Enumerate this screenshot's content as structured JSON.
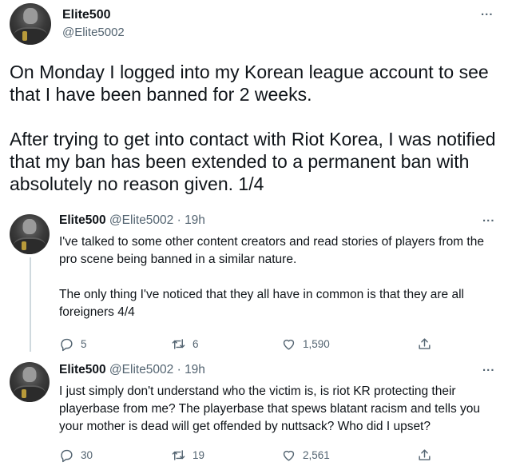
{
  "main_tweet": {
    "display_name": "Elite500",
    "handle": "@Elite5002",
    "more_label": "...",
    "paragraphs": [
      "On Monday I logged into my Korean league account to see that I have been banned for 2 weeks.",
      "After trying to get into contact with Riot Korea, I was notified that my ban has been extended to a permanent ban with absolutely no reason given.  1/4"
    ]
  },
  "replies": [
    {
      "display_name": "Elite500",
      "meta": "@Elite5002 · 19h",
      "more_label": "...",
      "paragraphs": [
        "I've talked to some other content creators and read stories of players from the pro scene being banned in a similar nature.",
        "The only thing I've noticed that they all have in common is that they are all foreigners 4/4"
      ],
      "replies_count": "5",
      "retweets_count": "6",
      "likes_count": "1,590"
    },
    {
      "display_name": "Elite500",
      "meta": "@Elite5002 · 19h",
      "more_label": "...",
      "paragraphs": [
        "I just simply don't understand who the victim is, is riot KR protecting their playerbase from me? The playerbase that spews blatant racism and tells you your mother is dead will get offended by nuttsack? Who did I upset?"
      ],
      "replies_count": "30",
      "retweets_count": "19",
      "likes_count": "2,561"
    }
  ],
  "icons": {
    "reply": "reply-icon",
    "retweet": "retweet-icon",
    "like": "like-icon",
    "share": "share-icon",
    "more": "more-icon"
  },
  "colors": {
    "text": "#0f1419",
    "secondary": "#536471",
    "thread_line": "#cfd9de"
  }
}
